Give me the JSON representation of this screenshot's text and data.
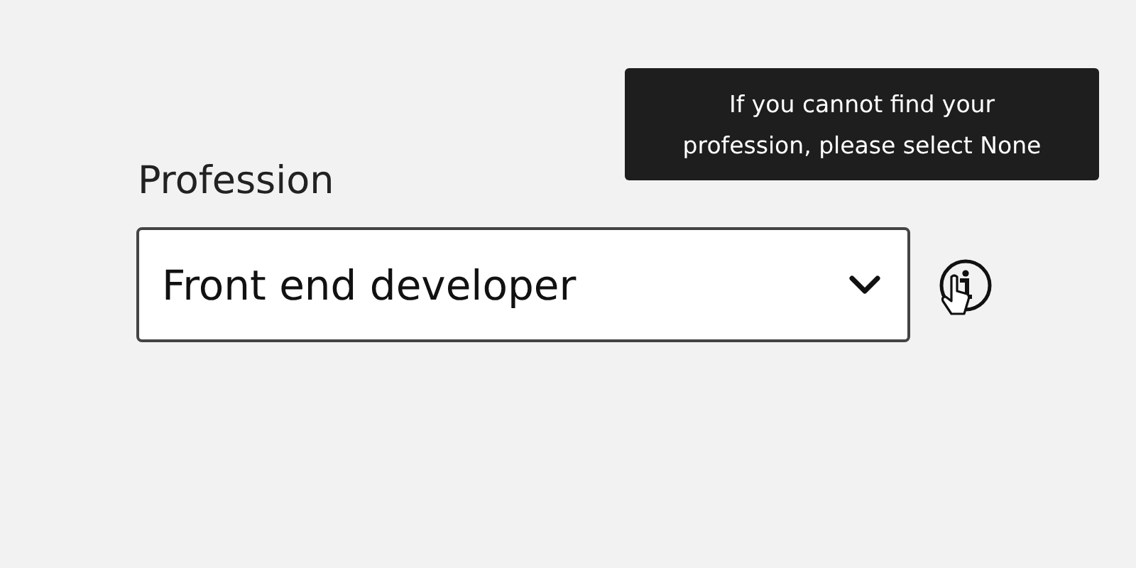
{
  "field": {
    "label": "Profession",
    "value": "Front end developer"
  },
  "tooltip": {
    "lines": [
      "If you cannot find your",
      "profession, please select None"
    ]
  }
}
